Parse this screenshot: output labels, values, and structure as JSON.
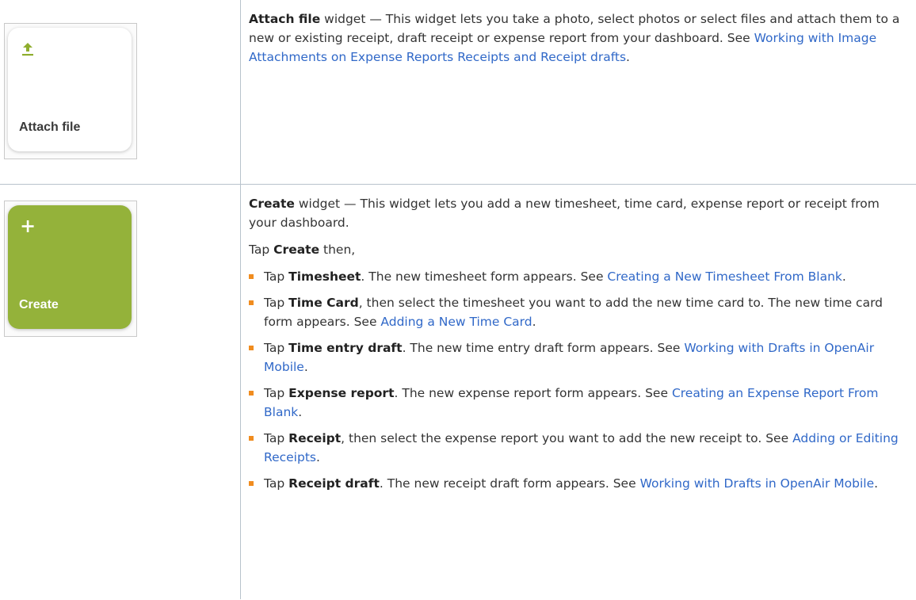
{
  "attach": {
    "tile_label": "Attach file",
    "title": "Attach file",
    "desc": " widget — This widget lets you take a photo, select photos or select files and attach them to a new or existing receipt, draft receipt or expense report from your dashboard. See ",
    "link": "Working with Image Attachments on Expense Reports Receipts and Receipt drafts",
    "end": "."
  },
  "create": {
    "tile_label": "Create",
    "title": "Create",
    "desc": " widget — This widget lets you add a new timesheet, time card, expense report or receipt from your dashboard.",
    "tap_pre": "Tap ",
    "tap_bold": "Create",
    "tap_post": " then,",
    "items": [
      {
        "pre": "Tap ",
        "bold": "Timesheet",
        "text": ". The new timesheet form appears. See ",
        "link": "Creating a New Timesheet From Blank",
        "end": "."
      },
      {
        "pre": "Tap ",
        "bold": "Time Card",
        "text": ", then select the timesheet you want to add the new time card to. The new time card form appears. See ",
        "link": "Adding a New Time Card",
        "end": "."
      },
      {
        "pre": "Tap ",
        "bold": "Time entry draft",
        "text": ". The new time entry draft form appears. See ",
        "link": "Working with Drafts in OpenAir Mobile",
        "end": "."
      },
      {
        "pre": "Tap ",
        "bold": "Expense report",
        "text": ". The new expense report form appears. See ",
        "link": "Creating an Expense Report From Blank",
        "end": "."
      },
      {
        "pre": "Tap ",
        "bold": "Receipt",
        "text": ", then select the expense report you want to add the new receipt to. See ",
        "link": "Adding or Editing Receipts",
        "end": "."
      },
      {
        "pre": "Tap ",
        "bold": "Receipt draft",
        "text": ". The new receipt draft form appears. See ",
        "link": "Working with Drafts in OpenAir Mobile",
        "end": "."
      }
    ]
  },
  "colors": {
    "link": "#3068c8",
    "bullet": "#f08c1f",
    "create_tile": "#94b23a",
    "upload_icon": "#8fae2e"
  },
  "icons": {
    "attach": "upload-icon",
    "create": "plus-icon"
  }
}
